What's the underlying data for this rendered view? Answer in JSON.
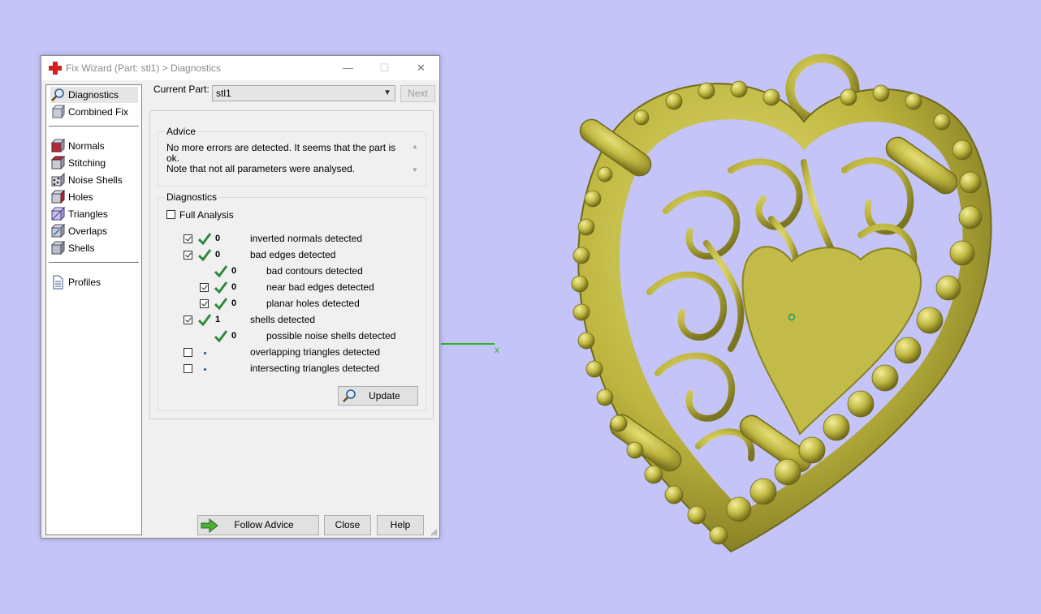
{
  "window": {
    "title": "Fix Wizard (Part: stl1) > Diagnostics",
    "minimize": "—",
    "maximize": "☐",
    "close": "✕"
  },
  "sidebar": {
    "items": [
      {
        "label": "Diagnostics",
        "icon": "magnifier-icon",
        "selected": true
      },
      {
        "label": "Combined Fix",
        "icon": "combined-fix-icon"
      },
      {
        "label": "Normals",
        "icon": "normals-cube-icon"
      },
      {
        "label": "Stitching",
        "icon": "stitching-cube-icon"
      },
      {
        "label": "Noise Shells",
        "icon": "noise-shells-cube-icon"
      },
      {
        "label": "Holes",
        "icon": "holes-cube-icon"
      },
      {
        "label": "Triangles",
        "icon": "triangles-cube-icon"
      },
      {
        "label": "Overlaps",
        "icon": "overlaps-cube-icon"
      },
      {
        "label": "Shells",
        "icon": "shells-cube-icon"
      },
      {
        "label": "Profiles",
        "icon": "document-icon"
      }
    ]
  },
  "header": {
    "current_part_label": "Current Part:",
    "current_part_value": "stl1",
    "next_label": "Next"
  },
  "advice": {
    "title": "Advice",
    "line1": "No more errors are detected. It seems that the part is ok.",
    "line2": "Note that not all parameters were analysed."
  },
  "diagnostics": {
    "title": "Diagnostics",
    "full_analysis_label": "Full Analysis",
    "full_analysis_checked": false,
    "rows": [
      {
        "checkbox": true,
        "checked": true,
        "status": "ok",
        "count": "0",
        "label": "inverted normals detected",
        "indent": 0
      },
      {
        "checkbox": true,
        "checked": true,
        "status": "ok",
        "count": "0",
        "label": "bad edges detected",
        "indent": 0
      },
      {
        "checkbox": false,
        "checked": false,
        "status": "ok",
        "count": "0",
        "label": "bad contours detected",
        "indent": 1
      },
      {
        "checkbox": true,
        "checked": true,
        "status": "ok",
        "count": "0",
        "label": "near bad edges detected",
        "indent": 1
      },
      {
        "checkbox": true,
        "checked": true,
        "status": "ok",
        "count": "0",
        "label": "planar holes detected",
        "indent": 1
      },
      {
        "checkbox": true,
        "checked": true,
        "status": "ok",
        "count": "1",
        "label": "shells detected",
        "indent": 0
      },
      {
        "checkbox": false,
        "checked": false,
        "status": "ok",
        "count": "0",
        "label": "possible noise shells detected",
        "indent": 1
      },
      {
        "checkbox": true,
        "checked": false,
        "status": "none",
        "count": "",
        "label": "overlapping triangles detected",
        "indent": 0
      },
      {
        "checkbox": true,
        "checked": false,
        "status": "none",
        "count": "",
        "label": "intersecting triangles detected",
        "indent": 0
      }
    ],
    "update_label": "Update"
  },
  "footer": {
    "follow_advice_label": "Follow Advice",
    "close_label": "Close",
    "help_label": "Help"
  },
  "viewport": {
    "axis_label": "x",
    "background": "#c4c4f8",
    "model_color": "#c8c14a"
  }
}
